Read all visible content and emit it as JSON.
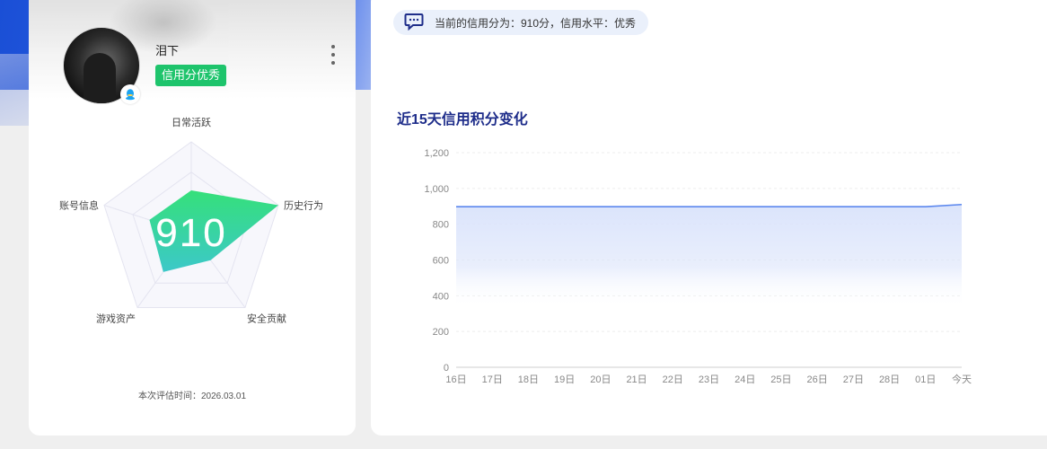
{
  "profile": {
    "username": "泪下",
    "credit_tag": "信用分优秀",
    "score_display": "910",
    "eval_time": "本次评估时间：2026.03.01"
  },
  "radar": {
    "axes": [
      "日常活跃",
      "历史行为",
      "安全贡献",
      "游戏资产",
      "账号信息"
    ],
    "values": [
      0.47,
      1.0,
      0.36,
      0.52,
      0.48
    ],
    "max": 1,
    "color": "#2fd68a"
  },
  "notice": {
    "text": "当前的信用分为：910分，信用水平：优秀"
  },
  "chart_data": {
    "type": "area",
    "title": "近15天信用积分变化",
    "categories": [
      "16日",
      "17日",
      "18日",
      "19日",
      "20日",
      "21日",
      "22日",
      "23日",
      "24日",
      "25日",
      "26日",
      "27日",
      "28日",
      "01日",
      "今天"
    ],
    "series": [
      {
        "values": [
          898,
          898,
          898,
          898,
          898,
          898,
          898,
          898,
          898,
          898,
          898,
          898,
          898,
          898,
          910
        ]
      }
    ],
    "ylim": [
      0,
      1200
    ],
    "yticks": [
      "0",
      "200",
      "400",
      "600",
      "800",
      "1,000",
      "1,200"
    ],
    "ytick_values": [
      0,
      200,
      400,
      600,
      800,
      1000,
      1200
    ],
    "line_color": "#5b87ee",
    "fill_color": "#dbe4fb",
    "grid": true
  }
}
